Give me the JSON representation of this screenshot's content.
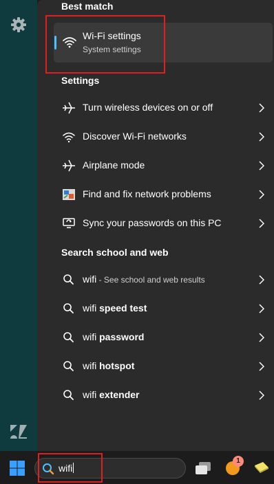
{
  "best_match": {
    "title": "Best match",
    "item_title": "Wi-Fi settings",
    "item_subtitle": "System settings"
  },
  "settings": {
    "title": "Settings",
    "items": [
      {
        "label": "Turn wireless devices on or off",
        "icon": "airplane-icon"
      },
      {
        "label": "Discover Wi-Fi networks",
        "icon": "wifi-icon"
      },
      {
        "label": "Airplane mode",
        "icon": "airplane-icon"
      },
      {
        "label": "Find and fix network problems",
        "icon": "network-troubleshoot-icon"
      },
      {
        "label": "Sync your passwords on this PC",
        "icon": "sync-icon"
      }
    ]
  },
  "web": {
    "title": "Search school and web",
    "items": [
      {
        "query": "wifi",
        "suffix": "",
        "hint": " - See school and web results"
      },
      {
        "query": "wifi",
        "suffix": " speed test",
        "hint": ""
      },
      {
        "query": "wifi",
        "suffix": " password",
        "hint": ""
      },
      {
        "query": "wifi",
        "suffix": " hotspot",
        "hint": ""
      },
      {
        "query": "wifi",
        "suffix": " extender",
        "hint": ""
      }
    ]
  },
  "taskbar": {
    "search_value": "wifi",
    "badge_count": "1"
  },
  "colors": {
    "accent": "#4cc2ff",
    "highlight": "#e02020",
    "panel": "#2b2b2b",
    "desktop": "#0f3b3e"
  }
}
